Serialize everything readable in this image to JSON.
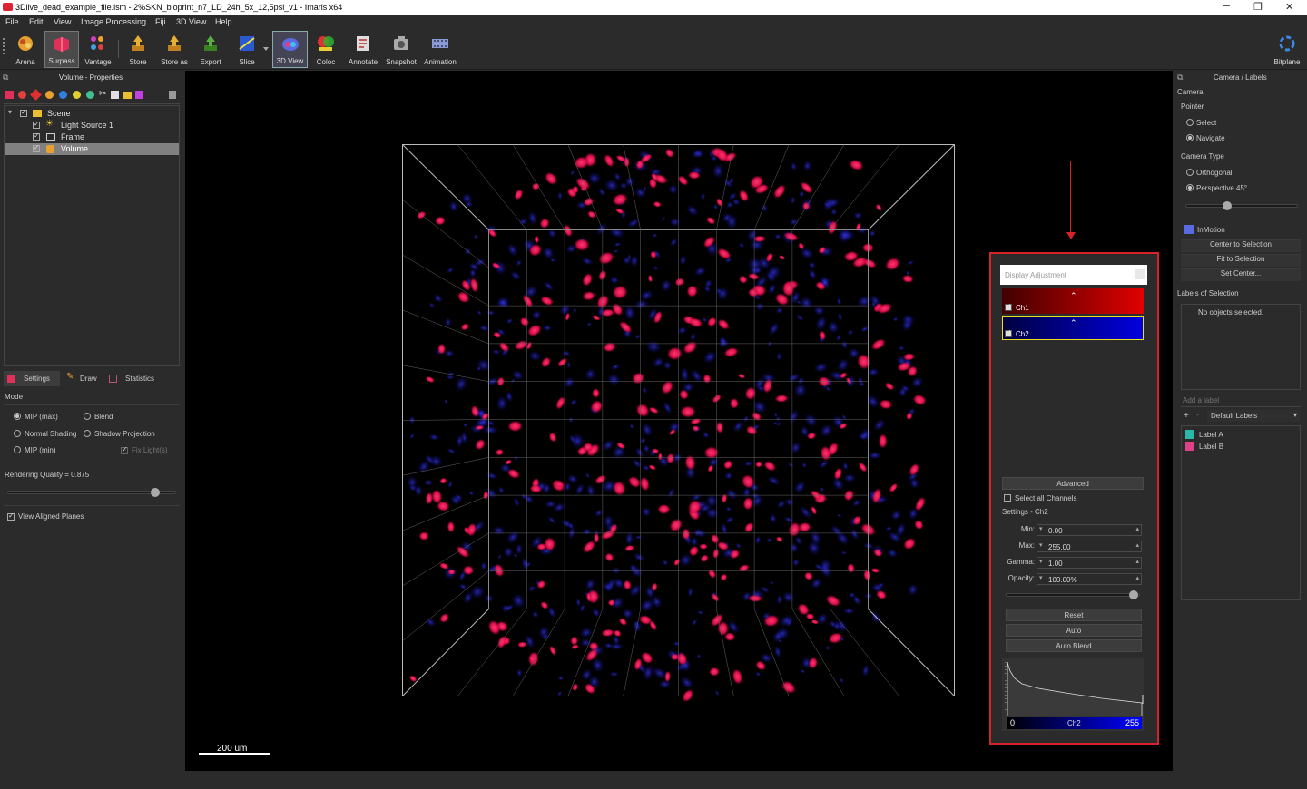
{
  "window": {
    "title": "3Dlive_dead_example_file.lsm - 2%SKN_bioprint_n7_LD_24h_5x_12,5psi_v1 - Imaris x64",
    "minimize": "─",
    "restore": "❐",
    "close": "✕"
  },
  "menu": [
    "File",
    "Edit",
    "View",
    "Image Processing",
    "Fiji",
    "3D View",
    "Help"
  ],
  "toolbar": {
    "buttons": [
      {
        "label": "Arena",
        "icon": "arena-icon",
        "color": "#e8a030"
      },
      {
        "label": "Surpass",
        "icon": "surpass-icon",
        "color": "#e0305a"
      },
      {
        "label": "Vantage",
        "icon": "vantage-icon",
        "color": "#d040c0"
      },
      {
        "label": "Store",
        "icon": "store-icon",
        "color": "#e8b030"
      },
      {
        "label": "Store as",
        "icon": "store-as-icon",
        "color": "#e8b030"
      },
      {
        "label": "Export",
        "icon": "export-icon",
        "color": "#58b040"
      },
      {
        "label": "Slice",
        "icon": "slice-icon",
        "color": "#3a7ae0"
      },
      {
        "label": "3D View",
        "icon": "3d-view-icon",
        "color": "#5a6ae0"
      },
      {
        "label": "Coloc",
        "icon": "coloc-icon",
        "color": "#e03030"
      },
      {
        "label": "Annotate",
        "icon": "annotate-icon",
        "color": "#dddddd"
      },
      {
        "label": "Snapshot",
        "icon": "snapshot-icon",
        "color": "#cccccc"
      },
      {
        "label": "Animation",
        "icon": "animation-icon",
        "color": "#8a9ad8"
      }
    ],
    "bitplane": "Bitplane"
  },
  "left_panel": {
    "title": "Volume - Properties",
    "tree": [
      {
        "label": "Scene",
        "icon": "folder-icon"
      },
      {
        "label": "Light Source 1",
        "icon": "light-source-icon"
      },
      {
        "label": "Frame",
        "icon": "frame-icon"
      },
      {
        "label": "Volume",
        "icon": "volume-icon"
      }
    ],
    "tabs": [
      "Settings",
      "Draw",
      "Statistics"
    ],
    "mode_label": "Mode",
    "modes": [
      "MIP (max)",
      "Blend",
      "Normal Shading",
      "Shadow Projection",
      "MIP (min)"
    ],
    "fix_lights": "Fix Light(s)",
    "rendering_quality": "Rendering Quality = 0.875",
    "rendering_quality_value": 0.875,
    "view_aligned": "View Aligned Planes"
  },
  "viewport": {
    "scale_bar": "200 um"
  },
  "display_adjustment": {
    "title": "Display Adjustment",
    "channels": [
      {
        "name": "Ch1",
        "color": "#e00000"
      },
      {
        "name": "Ch2",
        "color": "#0000e0"
      }
    ],
    "advanced": "Advanced",
    "select_all": "Select all Channels",
    "settings_label": "Settings - Ch2",
    "fields": [
      {
        "label": "Min:",
        "value": "0.00"
      },
      {
        "label": "Max:",
        "value": "255.00"
      },
      {
        "label": "Gamma:",
        "value": "1.00"
      },
      {
        "label": "Opacity:",
        "value": "100.00%"
      }
    ],
    "buttons": [
      "Reset",
      "Auto",
      "Auto Blend"
    ],
    "histogram": {
      "min_label": "0",
      "channel": "Ch2",
      "max_label": "255"
    }
  },
  "right_panel": {
    "title": "Camera / Labels",
    "camera": "Camera",
    "pointer": "Pointer",
    "pointer_options": [
      "Select",
      "Navigate"
    ],
    "camera_type": "Camera Type",
    "camera_type_options": [
      "Orthogonal",
      "Perspective 45°"
    ],
    "inmotion": "InMotion",
    "buttons": [
      "Center to Selection",
      "Fit to Selection",
      "Set Center..."
    ],
    "labels_of_selection": "Labels of Selection",
    "no_objects": "No objects selected.",
    "add_label": "Add a label",
    "label_set": "Default Labels",
    "labels": [
      {
        "name": "Label A",
        "color": "#2ab8a8"
      },
      {
        "name": "Label B",
        "color": "#e0408a"
      }
    ]
  }
}
